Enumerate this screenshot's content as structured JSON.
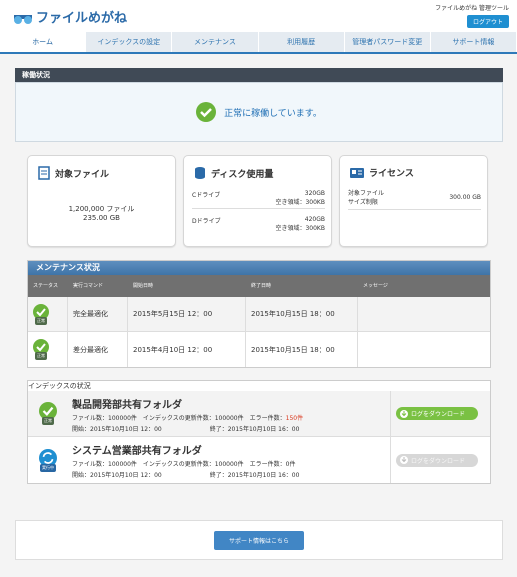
{
  "header": {
    "title": "ファイルめがね",
    "user": "ファイルめがね 管理ツール",
    "logout": "ログアウト"
  },
  "nav": [
    "ホーム",
    "インデックスの設定",
    "メンテナンス",
    "利用履歴",
    "管理者パスワード変更",
    "サポート情報"
  ],
  "status": {
    "heading": "稼働状況",
    "message": "正常に稼働しています。"
  },
  "cards": {
    "files": {
      "title": "対象ファイル",
      "line1": "1,200,000 ファイル",
      "line2": "235.00 GB"
    },
    "disk": {
      "title": "ディスク使用量",
      "rows": [
        {
          "label": "Cドライブ",
          "v1": "320GB",
          "v2": "空き領域：300KB"
        },
        {
          "label": "Dドライブ",
          "v1": "420GB",
          "v2": "空き領域：300KB"
        }
      ]
    },
    "license": {
      "title": "ライセンス",
      "label": "対象ファイル\nサイズ制限",
      "value": "300.00 GB"
    }
  },
  "maintenance": {
    "title": "メンテナンス状況",
    "headers": [
      "ステータス",
      "実行コマンド",
      "開始日時",
      "終了日時",
      "メッセージ"
    ],
    "rows": [
      {
        "status": "正常",
        "cmd": "完全最適化",
        "start": "2015年5月15日 12：00",
        "end": "2015年10月15日 18：00"
      },
      {
        "status": "正常",
        "cmd": "差分最適化",
        "start": "2015年4月10日 12：00",
        "end": "2015年10月15日 18：00"
      }
    ]
  },
  "index": {
    "title": "インデックスの状況",
    "rows": [
      {
        "status": "正常",
        "name": "製品開発部共有フォルダ",
        "line1a": "ファイル数：100000件　インデックスの更新件数：100000件　エラー件数：",
        "err": "150件",
        "line2": "開始：2015年10月10日 12：00　　　　　　　　終了：2015年10月10日 16：00",
        "btn": "ログをダウンロード"
      },
      {
        "status": "実行中",
        "name": "システム営業部共有フォルダ",
        "line1a": "ファイル数：100000件　インデックスの更新件数：100000件　エラー件数：",
        "err": "0件",
        "line2": "開始：2015年10月10日 12：00　　　　　　　　終了：2015年10月10日 16：00",
        "btn": "ログをダウンロード"
      }
    ]
  },
  "footer": {
    "button": "サポート情報はこちら"
  },
  "colors": {
    "accent": "#2e79b9",
    "ok": "#6ab33a",
    "error": "#d9381e"
  }
}
